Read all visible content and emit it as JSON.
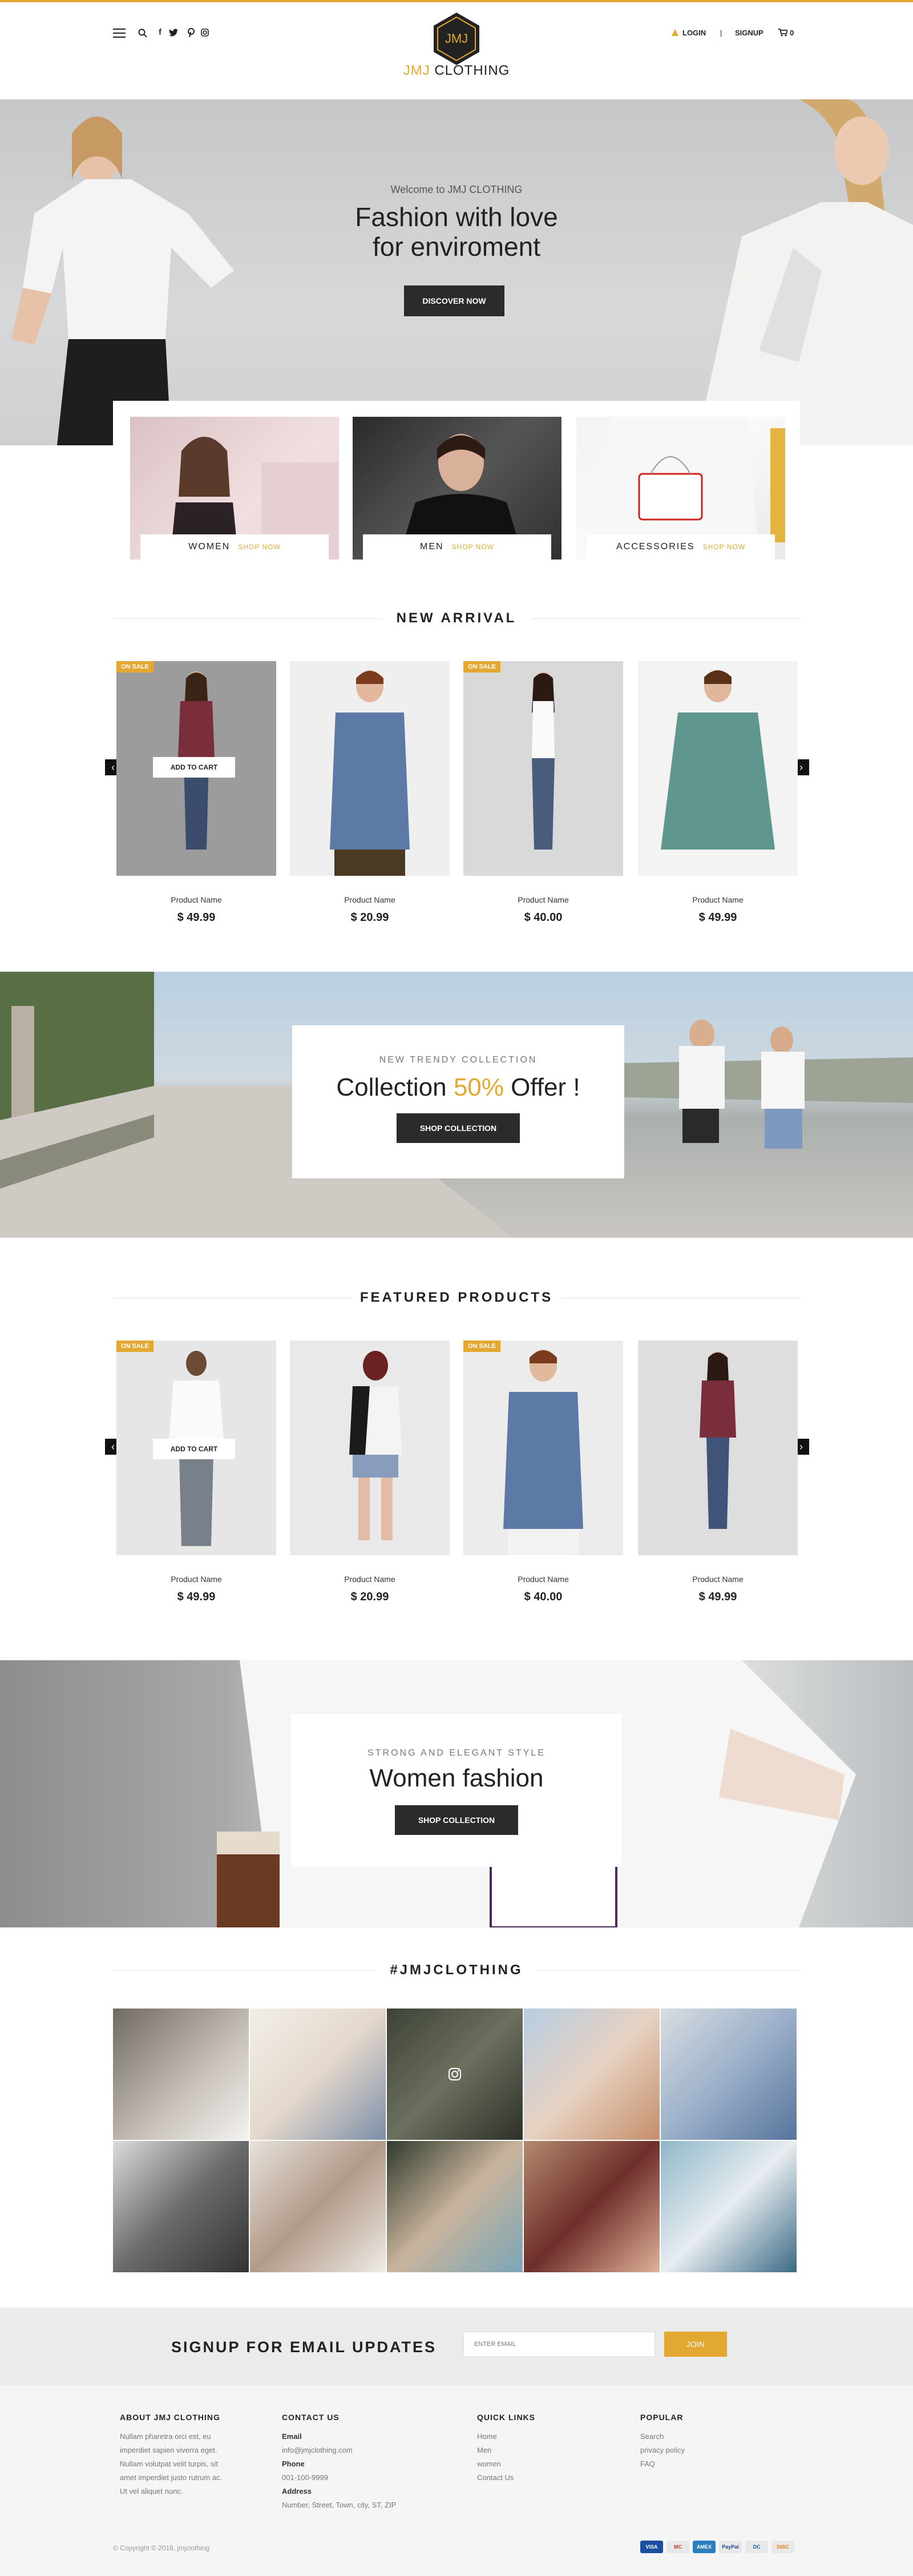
{
  "header": {
    "logo_mark": "JMJ",
    "logo_brand": "JMJ",
    "logo_word": "CLOTHING",
    "login": "LOGIN",
    "separator": "|",
    "signup": "SIGNUP",
    "cart_count": "0",
    "icons": [
      "menu-icon",
      "search-icon",
      "facebook-icon",
      "twitter-icon",
      "pinterest-icon",
      "instagram-icon",
      "user-icon",
      "cart-icon"
    ]
  },
  "hero": {
    "welcome": "Welcome to JMJ CLOTHING",
    "title_line1": "Fashion with love",
    "title_line2": "for enviroment",
    "button": "DISCOVER NOW"
  },
  "categories": [
    {
      "label": "WOMEN",
      "shop": "SHOP NOW"
    },
    {
      "label": "MEN",
      "shop": "SHOP NOW"
    },
    {
      "label": "ACCESSORIES",
      "shop": "SHOP NOW"
    }
  ],
  "new_arrival": {
    "title": "NEW ARRIVAL",
    "badge": "ON SALE",
    "add_to_cart": "ADD TO CART",
    "products": [
      {
        "name": "Product Name",
        "price": "$ 49.99"
      },
      {
        "name": "Product Name",
        "price": "$ 20.99"
      },
      {
        "name": "Product Name",
        "price": "$ 40.00"
      },
      {
        "name": "Product Name",
        "price": "$ 49.99"
      }
    ]
  },
  "collection_banner": {
    "subtitle": "NEW TRENDY COLLECTION",
    "title_pre": "Collection ",
    "title_hl": "50%",
    "title_post": " Offer !",
    "button": "SHOP COLLECTION"
  },
  "featured": {
    "title": "FEATURED PRODUCTS",
    "badge": "ON SALE",
    "add_to_cart": "ADD TO CART",
    "products": [
      {
        "name": "Product Name",
        "price": "$ 49.99"
      },
      {
        "name": "Product Name",
        "price": "$ 20.99"
      },
      {
        "name": "Product Name",
        "price": "$ 40.00"
      },
      {
        "name": "Product Name",
        "price": "$ 49.99"
      }
    ]
  },
  "women_banner": {
    "subtitle": "STRONG AND ELEGANT STYLE",
    "title": "Women fashion",
    "button": "SHOP COLLECTION"
  },
  "instagram": {
    "title": "#JMJCLOTHING"
  },
  "signup": {
    "title": "SIGNUP FOR EMAIL UPDATES",
    "placeholder": "ENTER EMAIL",
    "button": "JOIN"
  },
  "footer": {
    "about_title": "ABOUT JMJ CLOTHING",
    "about_lines": [
      "Nullam pharetra orci est, eu",
      "imperdiet sapien viverra eget.",
      "Nullam volutpat velit turpis, sit",
      "amet imperdiet justo rutrum ac.",
      "Ut vel aliquet nunc."
    ],
    "contact_title": "CONTACT US",
    "email_label": "Email",
    "email": "info@jmjclothing.com",
    "phone_label": "Phone",
    "phone": "001-100-9999",
    "address_label": "Address",
    "address": "Number, Street, Town, city, ST, ZIP",
    "links_title": "QUICK LINKS",
    "links": [
      "Home",
      "Men",
      "women",
      "Contact Us"
    ],
    "popular_title": "POPULAR",
    "popular": [
      "Search",
      "privacy policy",
      "FAQ"
    ],
    "copyright": "© Copyright © 2018, jmjclothing",
    "payments": [
      "VISA",
      "MC",
      "AMEX",
      "PayPal",
      "DC",
      "DISC"
    ]
  },
  "colors": {
    "accent": "#e2a832",
    "dark": "#2b2b2b",
    "signup_bg": "#ebebeb",
    "footer_bg": "#f5f5f5"
  }
}
